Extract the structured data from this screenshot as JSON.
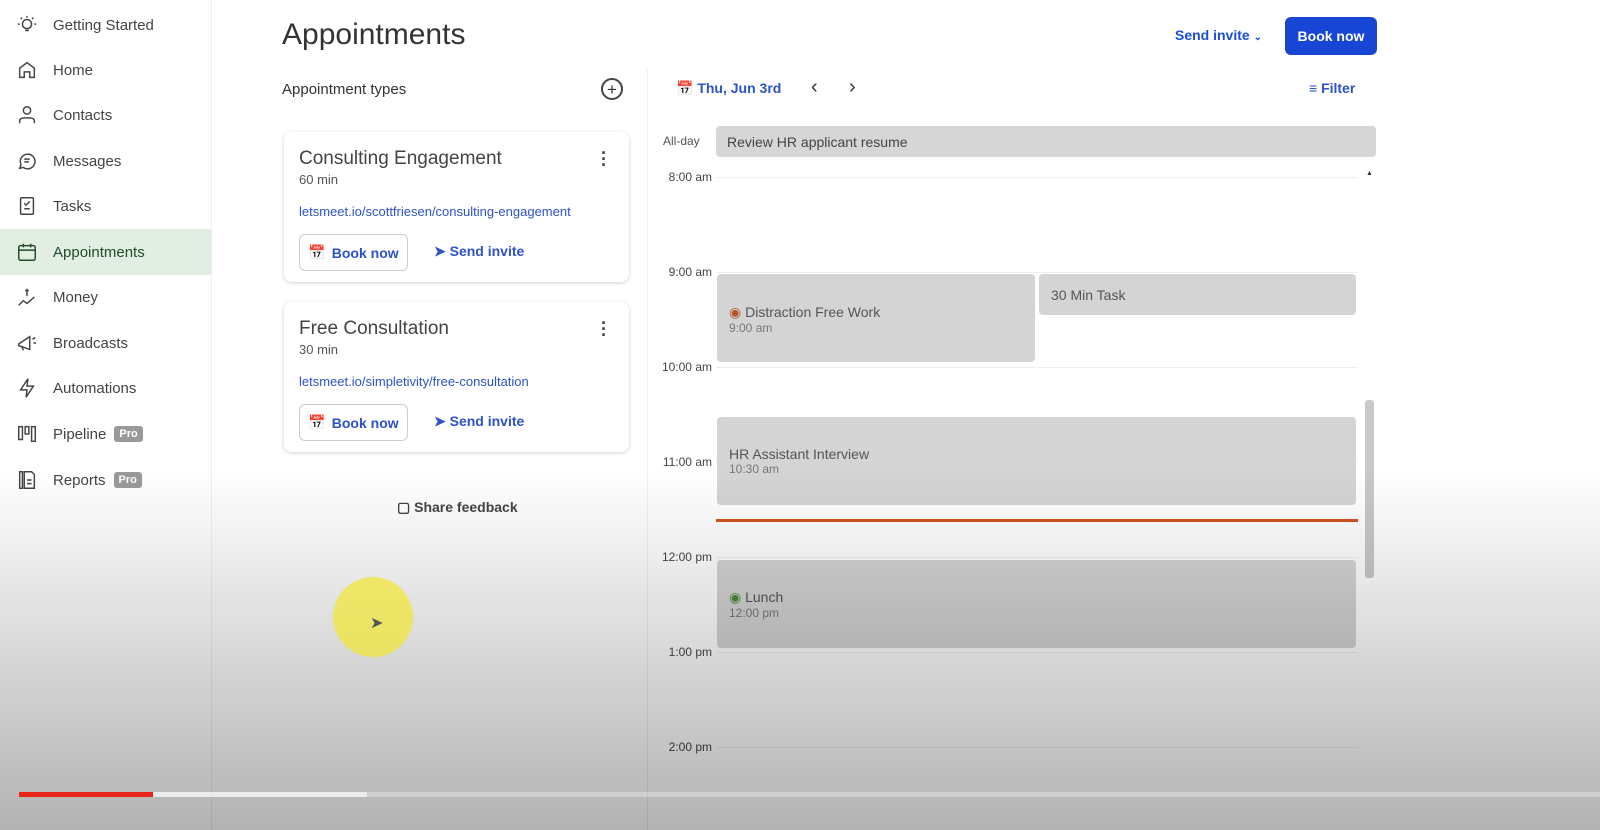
{
  "sidebar": {
    "items": [
      {
        "label": "Getting Started",
        "icon": "lightbulb-icon"
      },
      {
        "label": "Home",
        "icon": "home-icon"
      },
      {
        "label": "Contacts",
        "icon": "person-icon"
      },
      {
        "label": "Messages",
        "icon": "chat-icon"
      },
      {
        "label": "Tasks",
        "icon": "checklist-icon"
      },
      {
        "label": "Appointments",
        "icon": "calendar-icon",
        "active": true
      },
      {
        "label": "Money",
        "icon": "money-icon"
      },
      {
        "label": "Broadcasts",
        "icon": "megaphone-icon"
      },
      {
        "label": "Automations",
        "icon": "lightning-icon"
      },
      {
        "label": "Pipeline",
        "icon": "pipeline-icon",
        "badge": "Pro"
      },
      {
        "label": "Reports",
        "icon": "report-icon",
        "badge": "Pro"
      }
    ]
  },
  "header": {
    "title": "Appointments",
    "send_invite": "Send invite",
    "book_now": "Book now"
  },
  "types": {
    "heading": "Appointment types",
    "cards": [
      {
        "name": "Consulting Engagement",
        "duration": "60 min",
        "link": "letsmeet.io/scottfriesen/consulting-engagement",
        "book": "Book now",
        "send": "Send invite"
      },
      {
        "name": "Free Consultation",
        "duration": "30 min",
        "link": "letsmeet.io/simpletivity/free-consultation",
        "book": "Book now",
        "send": "Send invite"
      }
    ],
    "feedback": "Share feedback"
  },
  "calendar": {
    "date": "Thu, Jun 3rd",
    "filter": "Filter",
    "allday_label": "All-day",
    "allday_event": "Review HR applicant resume",
    "hours": [
      "8:00 am",
      "9:00 am",
      "10:00 am",
      "11:00 am",
      "12:00 pm",
      "1:00 pm",
      "2:00 pm"
    ],
    "events": [
      {
        "title": "Distraction Free Work",
        "time": "9:00 am"
      },
      {
        "title": "30 Min Task"
      },
      {
        "title": "HR Assistant Interview",
        "time": "10:30 am"
      },
      {
        "title": "Lunch",
        "time": "12:00 pm"
      }
    ]
  },
  "video": {
    "progress_fraction": 0.085,
    "buffered_fraction": 0.22
  },
  "colors": {
    "accent": "#1746d4",
    "link": "#2d52c9",
    "active_nav": "#e3eee3",
    "now_line": "#d2521f"
  }
}
